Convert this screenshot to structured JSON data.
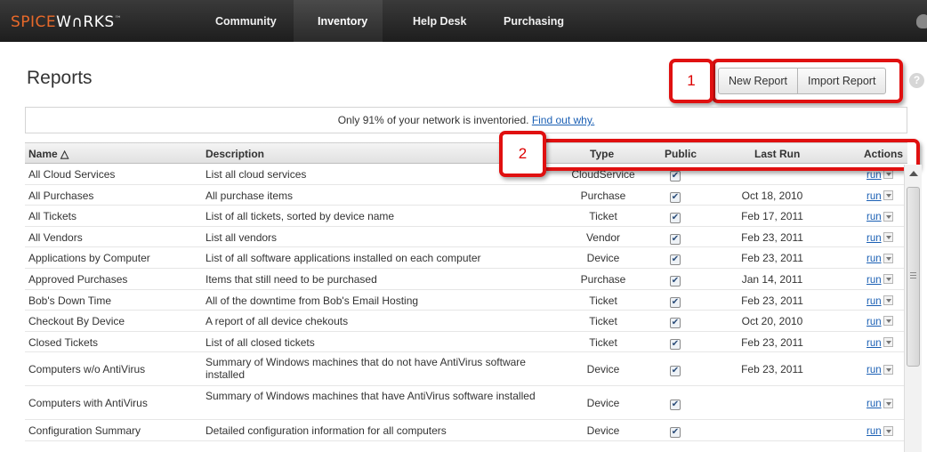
{
  "nav": {
    "logo_part1": "SPICE",
    "logo_part2": "W∩RKS",
    "logo_tm": "™",
    "items": [
      "Community",
      "Inventory",
      "Help Desk",
      "Purchasing"
    ],
    "active": "Inventory"
  },
  "header": {
    "title": "Reports",
    "new_report": "New Report",
    "import_report": "Import Report",
    "help": "?"
  },
  "callouts": [
    "1",
    "2"
  ],
  "notice": {
    "text": "Only 91% of your network is inventoried.",
    "link": "Find out why."
  },
  "table": {
    "columns": [
      "Name △",
      "Description",
      "Type",
      "Public",
      "Last Run",
      "Actions"
    ],
    "action_label": "run",
    "rows": [
      {
        "name": "All Cloud Services",
        "desc": "List all cloud services",
        "type": "CloudService",
        "public": true,
        "last_run": ""
      },
      {
        "name": "All Purchases",
        "desc": "All purchase items",
        "type": "Purchase",
        "public": true,
        "last_run": "Oct 18, 2010"
      },
      {
        "name": "All Tickets",
        "desc": "List of all tickets, sorted by device name",
        "type": "Ticket",
        "public": true,
        "last_run": "Feb 17, 2011"
      },
      {
        "name": "All Vendors",
        "desc": "List all vendors",
        "type": "Vendor",
        "public": true,
        "last_run": "Feb 23, 2011"
      },
      {
        "name": "Applications by Computer",
        "desc": "List of all software applications installed on each computer",
        "type": "Device",
        "public": true,
        "last_run": "Feb 23, 2011"
      },
      {
        "name": "Approved Purchases",
        "desc": "Items that still need to be purchased",
        "type": "Purchase",
        "public": true,
        "last_run": "Jan 14, 2011"
      },
      {
        "name": "Bob's Down Time",
        "desc": "All of the downtime from Bob's Email Hosting",
        "type": "Ticket",
        "public": true,
        "last_run": "Feb 23, 2011"
      },
      {
        "name": "Checkout By Device",
        "desc": "A report of all device chekouts",
        "type": "Ticket",
        "public": true,
        "last_run": "Oct 20, 2010"
      },
      {
        "name": "Closed Tickets",
        "desc": "List of all closed tickets",
        "type": "Ticket",
        "public": true,
        "last_run": "Feb 23, 2011"
      },
      {
        "name": "Computers w/o AntiVirus",
        "desc": "Summary of Windows machines that do not have AntiVirus software installed",
        "type": "Device",
        "public": true,
        "last_run": "Feb 23, 2011"
      },
      {
        "name": "Computers with AntiVirus",
        "desc": "Summary of Windows machines that have AntiVirus software installed",
        "type": "Device",
        "public": true,
        "last_run": ""
      },
      {
        "name": "Configuration Summary",
        "desc": "Detailed configuration information for all computers",
        "type": "Device",
        "public": true,
        "last_run": ""
      }
    ]
  },
  "colors": {
    "accent": "#e8692a",
    "callout": "#e01010",
    "link": "#1a5fb4"
  }
}
